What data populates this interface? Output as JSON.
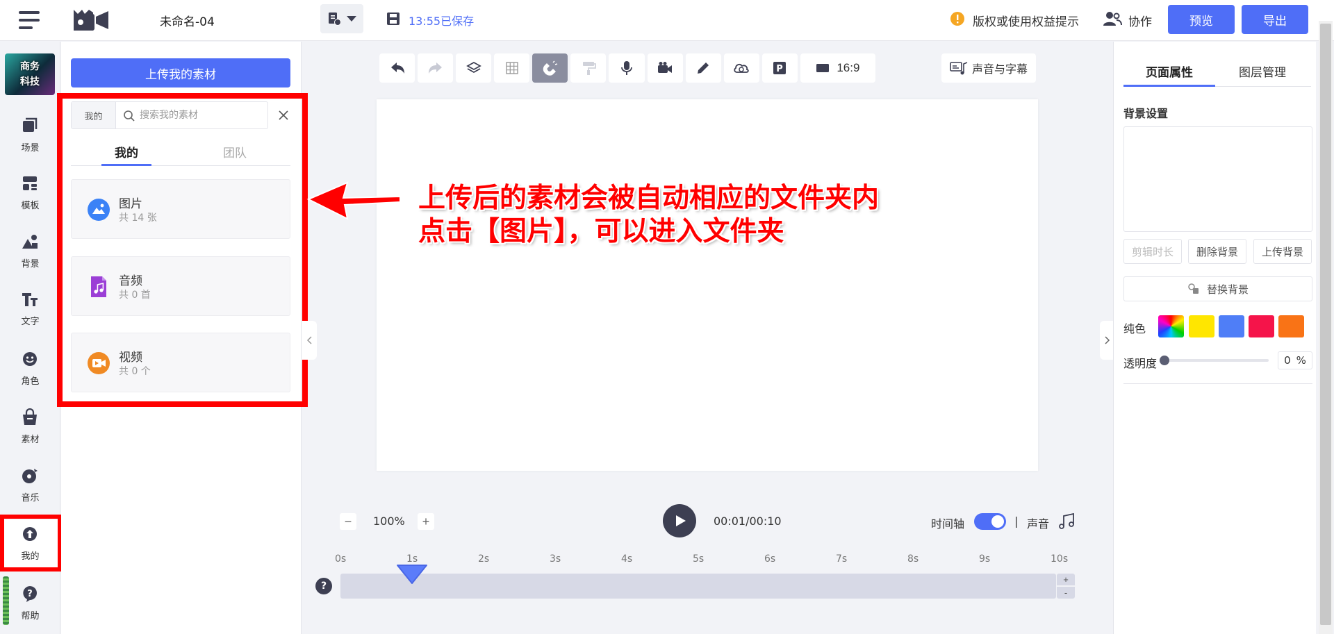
{
  "topbar": {
    "doc_title": "未命名-04",
    "save_status": "13:55已保存",
    "rights_notice": "版权或使用权益提示",
    "collab_label": "协作",
    "preview_label": "预览",
    "export_label": "导出"
  },
  "rail": {
    "avatar_line1": "商务",
    "avatar_line2": "科技",
    "items": [
      {
        "label": "场景",
        "icon": "scenes-icon"
      },
      {
        "label": "模板",
        "icon": "template-icon"
      },
      {
        "label": "背景",
        "icon": "background-icon"
      },
      {
        "label": "文字",
        "icon": "text-icon"
      },
      {
        "label": "角色",
        "icon": "character-icon"
      },
      {
        "label": "素材",
        "icon": "assets-bag-icon"
      },
      {
        "label": "音乐",
        "icon": "music-icon"
      },
      {
        "label": "我的",
        "icon": "upload-icon"
      },
      {
        "label": "帮助",
        "icon": "help-icon"
      }
    ]
  },
  "panel": {
    "upload_label": "上传我的素材",
    "search_scope": "我的",
    "search_placeholder": "搜索我的素材",
    "tab_mine": "我的",
    "tab_team": "团队",
    "folders": [
      {
        "name": "图片",
        "count": "共 14 张",
        "icon": "image-folder-icon",
        "color": "#3b82f6"
      },
      {
        "name": "音频",
        "count": "共 0 首",
        "icon": "audio-folder-icon",
        "color": "#9b3fd6"
      },
      {
        "name": "视频",
        "count": "共 0 个",
        "icon": "video-folder-icon",
        "color": "#f08a24"
      }
    ]
  },
  "toolbar": {
    "aspect_ratio": "16:9",
    "sound_subtitle": "声音与字幕"
  },
  "annotation": {
    "line1": "上传后的素材会被自动相应的文件夹内",
    "line2": "点击【图片】，可以进入文件夹"
  },
  "playback": {
    "zoom": "100%",
    "time": "00:01/00:10",
    "timeline_label": "时间轴",
    "separator": "|",
    "sound_label": "声音",
    "playhead_seconds": 1,
    "duration_seconds": 10,
    "ticks": [
      "0s",
      "1s",
      "2s",
      "3s",
      "4s",
      "5s",
      "6s",
      "7s",
      "8s",
      "9s",
      "10s"
    ],
    "help": "?"
  },
  "props": {
    "tab_page": "页面属性",
    "tab_layer": "图层管理",
    "bg_title": "背景设置",
    "trim_label": "剪辑时长",
    "delete_label": "删除背景",
    "upload_bg_label": "上传背景",
    "replace_label": "替换背景",
    "solid_label": "纯色",
    "swatches": [
      "rainbow",
      "#ffe600",
      "#4f7ef7",
      "#f5144a",
      "#f97316"
    ],
    "opacity_label": "透明度",
    "opacity_value": "0",
    "opacity_unit": "%"
  },
  "colors": {
    "accent": "#4f6ef7",
    "annotation_red": "#ff0000"
  }
}
